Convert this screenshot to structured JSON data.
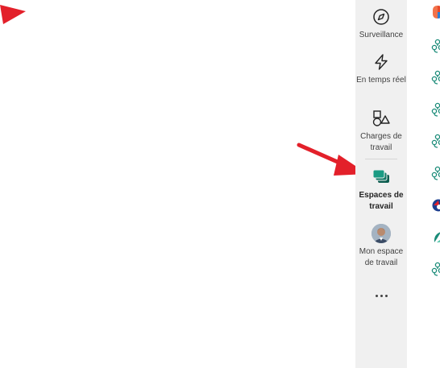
{
  "nav": {
    "items": [
      {
        "label": "Surveillance",
        "icon": "compass-icon"
      },
      {
        "label": "En temps réel",
        "icon": "lightning-icon"
      },
      {
        "label": "Charges de travail",
        "icon": "shapes-icon"
      },
      {
        "label": "Espaces de travail",
        "icon": "workspaces-icon",
        "active": true
      },
      {
        "label": "Mon espace de travail",
        "icon": "avatar"
      }
    ],
    "more_icon": "more-icon"
  },
  "colors": {
    "annotation_red": "#e3202a",
    "rail_bg": "#f0f0f0",
    "active_icon": "#117865",
    "workspace_icon": "#1a8b78"
  },
  "list_icons": [
    "fabric-logo-icon",
    "workspace-icon",
    "workspace-icon",
    "workspace-icon",
    "workspace-icon",
    "workspace-icon",
    "colorful-workspace-icon",
    "colorful-workspace-icon",
    "workspace-icon"
  ]
}
